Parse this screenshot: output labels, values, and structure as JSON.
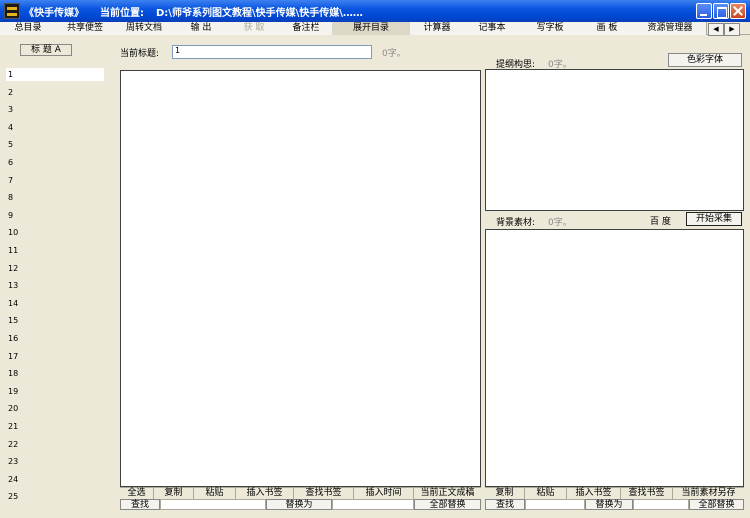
{
  "window": {
    "title": "《快手传媒》",
    "location_label": "当前位置:",
    "location_path": "D:\\师爷系列图文教程\\快手传媒\\快手传媒\\……"
  },
  "tabs": [
    {
      "label": "总目录",
      "state": "normal"
    },
    {
      "label": "共享便签",
      "state": "normal"
    },
    {
      "label": "周转文档",
      "state": "normal"
    },
    {
      "label": "输 出",
      "state": "normal"
    },
    {
      "label": "获 取",
      "state": "disabled"
    },
    {
      "label": "备注栏",
      "state": "normal"
    },
    {
      "label": "展开目录",
      "state": "active"
    },
    {
      "label": "计算器",
      "state": "normal"
    },
    {
      "label": "记事本",
      "state": "normal"
    },
    {
      "label": "写字板",
      "state": "normal"
    },
    {
      "label": "画 板",
      "state": "normal"
    },
    {
      "label": "资源管理器",
      "state": "normal"
    }
  ],
  "tab_scroll": {
    "left": "◀",
    "right": "▶"
  },
  "sidebar": {
    "sort_label": "标 题 A",
    "rows": [
      "1",
      "2",
      "3",
      "4",
      "5",
      "6",
      "7",
      "8",
      "9",
      "10",
      "11",
      "12",
      "13",
      "14",
      "15",
      "16",
      "17",
      "18",
      "19",
      "20",
      "21",
      "22",
      "23",
      "24",
      "25"
    ]
  },
  "editor": {
    "title_label": "当前标题:",
    "title_value": "1",
    "char_count": "0字。",
    "buttons": [
      "全选",
      "复制",
      "粘贴",
      "插入书签",
      "查找书签",
      "插入时间",
      "当前正文成稿"
    ],
    "find_label": "查找",
    "replace_label": "替换为",
    "replace_all_label": "全部替换"
  },
  "outline": {
    "label": "提纲构思:",
    "char_count": "0字。",
    "color_font_label": "色彩字体"
  },
  "material": {
    "label": "背景素材:",
    "char_count": "0字。",
    "baidu_label": "百 度",
    "collect_label": "开始采集",
    "buttons": [
      "复制",
      "粘贴",
      "插入书签",
      "查找书签",
      "当前素材另存"
    ],
    "find_label": "查找",
    "replace_label": "替换为",
    "replace_all_label": "全部替换"
  }
}
